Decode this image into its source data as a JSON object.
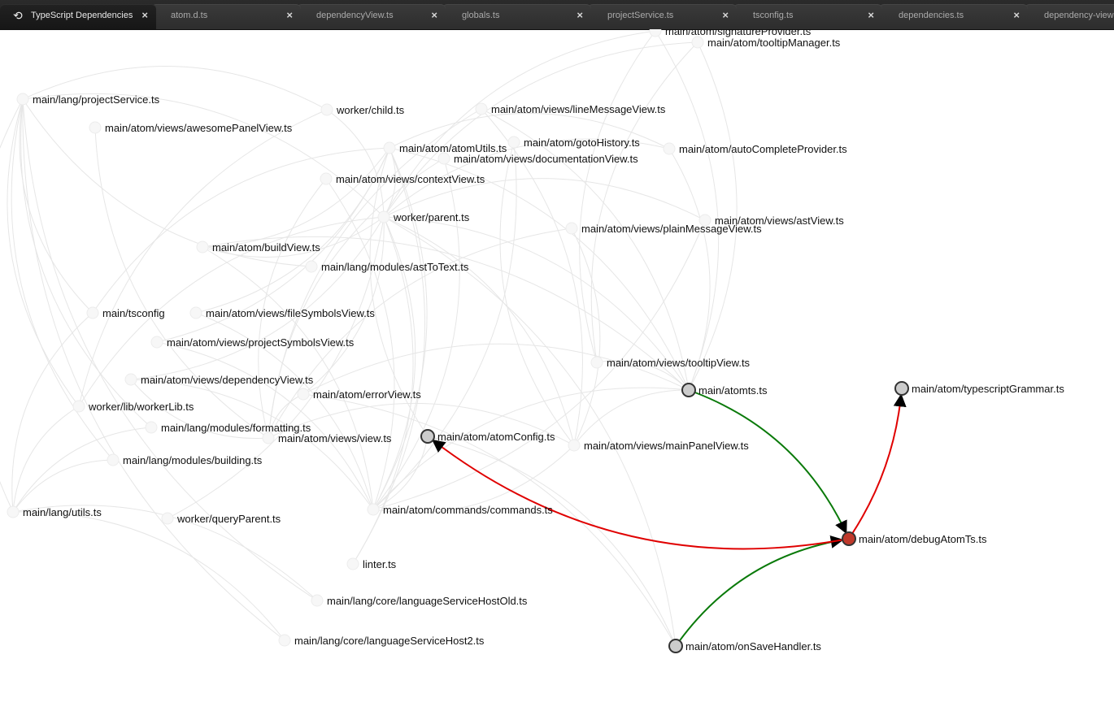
{
  "tabs": [
    {
      "label": "TypeScript Dependencies",
      "icon": "dependency-graph-icon",
      "active": true
    },
    {
      "label": "atom.d.ts"
    },
    {
      "label": "dependencyView.ts"
    },
    {
      "label": "globals.ts"
    },
    {
      "label": "projectService.ts"
    },
    {
      "label": "tsconfig.ts"
    },
    {
      "label": "dependencies.ts"
    },
    {
      "label": "dependency-view.le"
    }
  ],
  "close_glyph": "×",
  "graph": {
    "colors": {
      "edge_faint": "#e6e6e6",
      "edge_out": "#e00000",
      "edge_in": "#0a7a0a",
      "node_selected": "#c0392b",
      "node_linked": "#cccccc",
      "node_faint": "#f7f7f7"
    },
    "nodes": [
      {
        "id": "signature",
        "label": "main/atom/signatureProvider.ts",
        "state": "faint"
      },
      {
        "id": "tooltipManager",
        "label": "main/atom/tooltipManager.ts",
        "state": "faint"
      },
      {
        "id": "projectService",
        "label": "main/lang/projectService.ts",
        "state": "faint"
      },
      {
        "id": "child",
        "label": "worker/child.ts",
        "state": "faint"
      },
      {
        "id": "lineMessageView",
        "label": "main/atom/views/lineMessageView.ts",
        "state": "faint"
      },
      {
        "id": "awesomePanelView",
        "label": "main/atom/views/awesomePanelView.ts",
        "state": "faint"
      },
      {
        "id": "gotoHistory",
        "label": "main/atom/gotoHistory.ts",
        "state": "faint"
      },
      {
        "id": "atomUtils",
        "label": "main/atom/atomUtils.ts",
        "state": "faint"
      },
      {
        "id": "autoComplete",
        "label": "main/atom/autoCompleteProvider.ts",
        "state": "faint"
      },
      {
        "id": "documentationView",
        "label": "main/atom/views/documentationView.ts",
        "state": "faint"
      },
      {
        "id": "contextView",
        "label": "main/atom/views/contextView.ts",
        "state": "faint"
      },
      {
        "id": "parent",
        "label": "worker/parent.ts",
        "state": "faint"
      },
      {
        "id": "astView",
        "label": "main/atom/views/astView.ts",
        "state": "faint"
      },
      {
        "id": "plainMessageView",
        "label": "main/atom/views/plainMessageView.ts",
        "state": "faint"
      },
      {
        "id": "buildView",
        "label": "main/atom/buildView.ts",
        "state": "faint"
      },
      {
        "id": "astToText",
        "label": "main/lang/modules/astToText.ts",
        "state": "faint"
      },
      {
        "id": "tsconfig",
        "label": "main/tsconfig",
        "state": "faint"
      },
      {
        "id": "fileSymbolsView",
        "label": "main/atom/views/fileSymbolsView.ts",
        "state": "faint"
      },
      {
        "id": "projectSymbolsView",
        "label": "main/atom/views/projectSymbolsView.ts",
        "state": "faint"
      },
      {
        "id": "tooltipView",
        "label": "main/atom/views/tooltipView.ts",
        "state": "faint"
      },
      {
        "id": "dependencyView",
        "label": "main/atom/views/dependencyView.ts",
        "state": "faint"
      },
      {
        "id": "atomts",
        "label": "main/atomts.ts",
        "state": "linked"
      },
      {
        "id": "typescriptGrammar",
        "label": "main/atom/typescriptGrammar.ts",
        "state": "linked"
      },
      {
        "id": "errorView",
        "label": "main/atom/errorView.ts",
        "state": "faint"
      },
      {
        "id": "workerLib",
        "label": "worker/lib/workerLib.ts",
        "state": "faint"
      },
      {
        "id": "formatting",
        "label": "main/lang/modules/formatting.ts",
        "state": "faint"
      },
      {
        "id": "view",
        "label": "main/atom/views/view.ts",
        "state": "faint"
      },
      {
        "id": "atomConfig",
        "label": "main/atom/atomConfig.ts",
        "state": "linked"
      },
      {
        "id": "mainPanelView",
        "label": "main/atom/views/mainPanelView.ts",
        "state": "faint"
      },
      {
        "id": "building",
        "label": "main/lang/modules/building.ts",
        "state": "faint"
      },
      {
        "id": "utils",
        "label": "main/lang/utils.ts",
        "state": "faint"
      },
      {
        "id": "queryParent",
        "label": "worker/queryParent.ts",
        "state": "faint"
      },
      {
        "id": "commands",
        "label": "main/atom/commands/commands.ts",
        "state": "faint"
      },
      {
        "id": "debugAtomTs",
        "label": "main/atom/debugAtomTs.ts",
        "state": "selected"
      },
      {
        "id": "linter",
        "label": "linter.ts",
        "state": "faint"
      },
      {
        "id": "lsHostOld",
        "label": "main/lang/core/languageServiceHostOld.ts",
        "state": "faint"
      },
      {
        "id": "lsHost2",
        "label": "main/lang/core/languageServiceHost2.ts",
        "state": "faint"
      },
      {
        "id": "onSaveHandler",
        "label": "main/atom/onSaveHandler.ts",
        "state": "linked"
      }
    ],
    "highlighted_edges": [
      {
        "from": "atomts",
        "to": "debugAtomTs",
        "kind": "in"
      },
      {
        "from": "onSaveHandler",
        "to": "debugAtomTs",
        "kind": "in"
      },
      {
        "from": "debugAtomTs",
        "to": "typescriptGrammar",
        "kind": "out"
      },
      {
        "from": "debugAtomTs",
        "to": "atomConfig",
        "kind": "out"
      }
    ],
    "faint_edges": [
      [
        "projectService",
        "tsconfig"
      ],
      [
        "projectService",
        "utils"
      ],
      [
        "projectService",
        "building"
      ],
      [
        "projectService",
        "formatting"
      ],
      [
        "projectService",
        "astToText"
      ],
      [
        "projectService",
        "workerLib"
      ],
      [
        "projectService",
        "lsHost2"
      ],
      [
        "projectService",
        "lsHostOld"
      ],
      [
        "child",
        "projectService"
      ],
      [
        "child",
        "workerLib"
      ],
      [
        "parent",
        "child"
      ],
      [
        "parent",
        "workerLib"
      ],
      [
        "parent",
        "atomUtils"
      ],
      [
        "parent",
        "projectService"
      ],
      [
        "queryParent",
        "parent"
      ],
      [
        "atomUtils",
        "atomConfig"
      ],
      [
        "atomUtils",
        "tsconfig"
      ],
      [
        "buildView",
        "parent"
      ],
      [
        "buildView",
        "atomUtils"
      ],
      [
        "errorView",
        "view"
      ],
      [
        "errorView",
        "parent"
      ],
      [
        "mainPanelView",
        "view"
      ],
      [
        "mainPanelView",
        "parent"
      ],
      [
        "mainPanelView",
        "lineMessageView"
      ],
      [
        "mainPanelView",
        "plainMessageView"
      ],
      [
        "commands",
        "parent"
      ],
      [
        "commands",
        "atomUtils"
      ],
      [
        "commands",
        "mainPanelView"
      ],
      [
        "commands",
        "fileSymbolsView"
      ],
      [
        "commands",
        "projectSymbolsView"
      ],
      [
        "commands",
        "contextView"
      ],
      [
        "commands",
        "dependencyView"
      ],
      [
        "commands",
        "astView"
      ],
      [
        "commands",
        "gotoHistory"
      ],
      [
        "commands",
        "documentationView"
      ],
      [
        "commands",
        "buildView"
      ],
      [
        "commands",
        "atomConfig"
      ],
      [
        "atomts",
        "tooltipManager"
      ],
      [
        "atomts",
        "signature"
      ],
      [
        "atomts",
        "autoComplete"
      ],
      [
        "atomts",
        "commands"
      ],
      [
        "atomts",
        "mainPanelView"
      ],
      [
        "atomts",
        "parent"
      ],
      [
        "atomts",
        "errorView"
      ],
      [
        "atomts",
        "tooltipView"
      ],
      [
        "atomts",
        "atomUtils"
      ],
      [
        "atomts",
        "lineMessageView"
      ],
      [
        "atomts",
        "buildView"
      ],
      [
        "autoComplete",
        "parent"
      ],
      [
        "autoComplete",
        "atomUtils"
      ],
      [
        "tooltipManager",
        "parent"
      ],
      [
        "tooltipManager",
        "tooltipView"
      ],
      [
        "signature",
        "parent"
      ],
      [
        "signature",
        "tooltipView"
      ],
      [
        "dependencyView",
        "parent"
      ],
      [
        "dependencyView",
        "view"
      ],
      [
        "astView",
        "parent"
      ],
      [
        "fileSymbolsView",
        "atomUtils"
      ],
      [
        "projectSymbolsView",
        "atomUtils"
      ],
      [
        "gotoHistory",
        "mainPanelView"
      ],
      [
        "documentationView",
        "view"
      ],
      [
        "contextView",
        "view"
      ],
      [
        "onSaveHandler",
        "parent"
      ],
      [
        "onSaveHandler",
        "atomConfig"
      ],
      [
        "onSaveHandler",
        "errorView"
      ],
      [
        "lsHostOld",
        "utils"
      ],
      [
        "lsHost2",
        "utils"
      ],
      [
        "formatting",
        "utils"
      ],
      [
        "building",
        "utils"
      ],
      [
        "tsconfig",
        "utils"
      ],
      [
        "awesomePanelView",
        "view"
      ],
      [
        "linter",
        "parent"
      ],
      [
        "linter",
        "atomUtils"
      ],
      [
        "workerLib",
        "utils"
      ],
      [
        "plainMessageView",
        "view"
      ],
      [
        "lineMessageView",
        "view"
      ]
    ]
  }
}
